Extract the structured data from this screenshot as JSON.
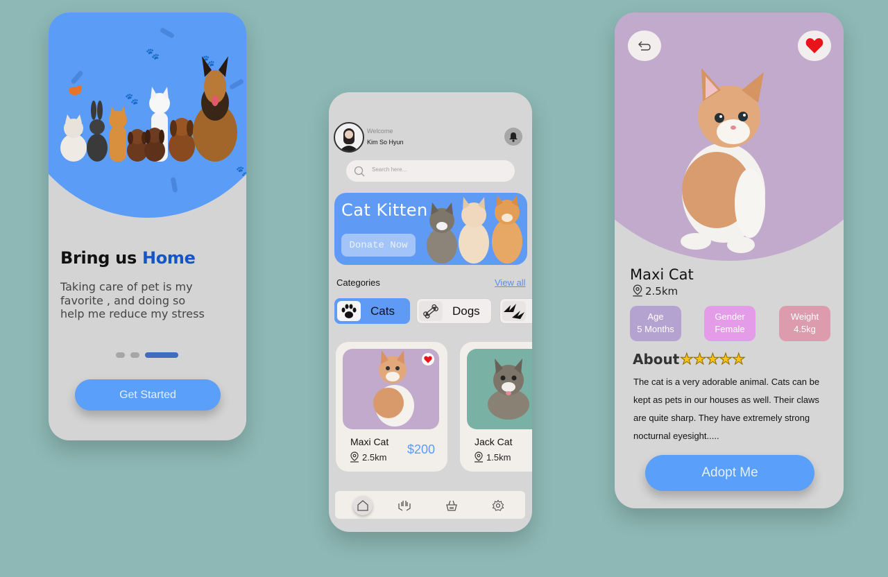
{
  "onboarding": {
    "title_prefix": "Bring us",
    "title_highlight": "Home",
    "description": "Taking care of pet is my favorite , and doing so help me reduce my stress",
    "cta_label": "Get Started",
    "page_indicator": {
      "count": 3,
      "active_index": 2
    }
  },
  "home": {
    "welcome_label": "Welcome",
    "user_name": "Kim So Hyun",
    "search_placeholder": "Search here...",
    "banner_title": "Cat Kitten",
    "banner_button": "Donate Now",
    "categories_label": "Categories",
    "view_all_label": "View all",
    "categories": [
      {
        "label": "Cats",
        "icon": "paw-icon",
        "active": true
      },
      {
        "label": "Dogs",
        "icon": "bone-icon",
        "active": false
      },
      {
        "label": "",
        "icon": "birds-icon",
        "active": false
      }
    ],
    "cards": [
      {
        "name": "Maxi Cat",
        "distance": "2.5km",
        "price": "$200",
        "favorite": true
      },
      {
        "name": "Jack Cat",
        "distance": "1.5km",
        "price": "",
        "favorite": false
      }
    ],
    "nav": [
      "home-icon",
      "hands-icon",
      "basket-icon",
      "gear-icon"
    ]
  },
  "detail": {
    "name": "Maxi Cat",
    "distance": "2.5km",
    "stats": [
      {
        "label": "Age",
        "value": "5 Months",
        "color": "#b4a2d1"
      },
      {
        "label": "Gender",
        "value": "Female",
        "color": "#e49be8"
      },
      {
        "label": "Weight",
        "value": "4.5kg",
        "color": "#dd9cad"
      }
    ],
    "about_label": "About",
    "rating_stars": "★★★★★",
    "description": "The cat is a very adorable animal. Cats can be kept as pets  in our houses as well. Their claws are quite sharp. They have extremely strong nocturnal eyesight.....",
    "cta_label": "Adopt Me"
  },
  "colors": {
    "background": "#8db8b5",
    "accent_blue": "#5a9ff9",
    "hero_blue": "#5b9cf7",
    "hero_purple": "#c1aacc",
    "heart_red": "#e8141a"
  }
}
